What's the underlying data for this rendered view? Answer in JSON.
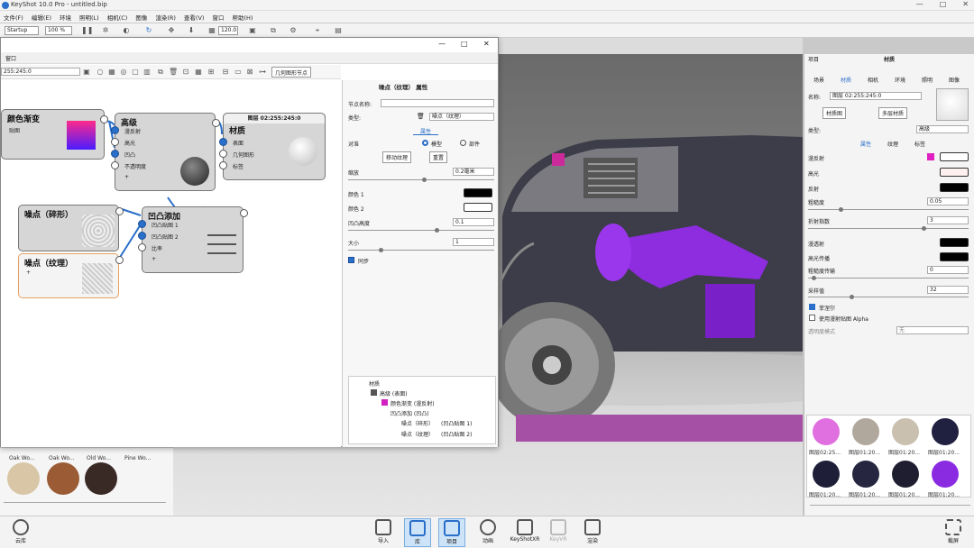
{
  "app": {
    "title": "KeyShot 10.0 Pro - untitled.bip",
    "window_controls": [
      "—",
      "□",
      "✕"
    ]
  },
  "menu": [
    "文件(F)",
    "编辑(E)",
    "环境",
    "照明(L)",
    "相机(C)",
    "图像",
    "渲染(R)",
    "查看(V)",
    "窗口",
    "帮助(H)"
  ],
  "toolbar": {
    "workspace": "Startup",
    "zoom": "100 %",
    "value": "120.0"
  },
  "graph_window": {
    "title_controls": [
      "—",
      "□",
      "✕"
    ],
    "tab": "窗口",
    "material_field": "255:245:0",
    "geom_node_button": "几何图形节点",
    "nodes": {
      "gradient": {
        "title": "颜色渐变",
        "rows": [
          "贴图"
        ]
      },
      "advanced": {
        "title": "高级",
        "rows": [
          "漫反射",
          "高光",
          "凹凸",
          "不透明度",
          "+"
        ]
      },
      "material": {
        "title": "材质",
        "header": "图层 02:255:245:0",
        "rows": [
          "表面",
          "几何图形",
          "标签"
        ]
      },
      "noise_fractal": {
        "title": "噪点（碎形）"
      },
      "bump_add": {
        "title": "凹凸添加",
        "rows": [
          "凹凸贴图 1",
          "凹凸贴图 2",
          "比率",
          "+"
        ]
      },
      "noise_texture": {
        "title": "噪点（纹理）",
        "rows": [
          "+"
        ]
      }
    },
    "properties": {
      "header": "噪点（纹理） 属性",
      "node_name_label": "节点名称:",
      "type_label": "类型:",
      "type_value": "噪点（纹理）",
      "tab": "属性",
      "target_label": "对准",
      "radio_model": "模型",
      "radio_part": "部件",
      "move_texture": "移动纹理",
      "reset": "重置",
      "scale_label": "缩放",
      "scale_value": "0.2毫米",
      "color1_label": "颜色 1",
      "color2_label": "颜色 2",
      "bump_label": "凹凸高度",
      "bump_value": "0.1",
      "size_label": "大小",
      "size_value": "1",
      "sync_label": "同步",
      "tree": [
        {
          "label": "材质",
          "extra": ""
        },
        {
          "label": "高级 (表面)",
          "extra": ""
        },
        {
          "label": "颜色渐变 (漫反射)",
          "extra": ""
        },
        {
          "label": "凹凸添加 (凹凸)",
          "extra": ""
        },
        {
          "label": "噪点（碎形）",
          "extra": "(凹凸贴图 1)"
        },
        {
          "label": "噪点（纹理）",
          "extra": "(凹凸贴图 2)"
        }
      ]
    }
  },
  "library": {
    "items": [
      {
        "label": "Oak Wo...",
        "color": "#d8c6a6"
      },
      {
        "label": "Oak Wo...",
        "color": "#9a5b35"
      },
      {
        "label": "Old Wo...",
        "color": "#3a2a26"
      },
      {
        "label": "Pine Wo...",
        "color": "#c9a070"
      }
    ]
  },
  "right_panel": {
    "header_left": "项目",
    "header_title": "材质",
    "tabs": [
      "场景",
      "材质",
      "相机",
      "环境",
      "照明",
      "图像"
    ],
    "name_label": "名称:",
    "name_value": "图层 02:255:245:0",
    "material_graph_btn": "材质图",
    "multi_layer_btn": "多层材质",
    "type_label": "类型:",
    "type_value": "高级",
    "subtabs": [
      "属性",
      "纹理",
      "标签"
    ],
    "props": [
      {
        "label": "漫反射",
        "kind": "color",
        "color": "#ffffff"
      },
      {
        "label": "高光",
        "kind": "color",
        "color": "#fdf0ee"
      },
      {
        "label": "反射",
        "kind": "color",
        "color": "#000000"
      },
      {
        "label": "粗糙度",
        "kind": "num",
        "value": "0.05"
      },
      {
        "label": "折射指数",
        "kind": "num",
        "value": "3"
      },
      {
        "label": "漫透射",
        "kind": "color",
        "color": "#000000"
      },
      {
        "label": "高光传播",
        "kind": "color",
        "color": "#000000"
      },
      {
        "label": "粗糙度传输",
        "kind": "num",
        "value": "0"
      },
      {
        "label": "采样值",
        "kind": "num",
        "value": "32"
      }
    ],
    "fresnel": "菲涅尔",
    "alpha": "使用漫射贴图 Alpha",
    "transparency_label": "透明度模式",
    "transparency_value": "无",
    "swatches": [
      {
        "label": "图层02:25...",
        "color": "#e070e0"
      },
      {
        "label": "图层01:20...",
        "color": "#b0a89c"
      },
      {
        "label": "图层01:20...",
        "color": "#c9c0b0"
      },
      {
        "label": "图层01:20...",
        "color": "#202040"
      },
      {
        "label": "图层01:20...",
        "color": "#1e1e38"
      },
      {
        "label": "图层01:20...",
        "color": "#262640"
      },
      {
        "label": "图层01:20...",
        "color": "#1e1e30"
      },
      {
        "label": "图层01:20...",
        "color": "#8a2be2"
      }
    ]
  },
  "bottom": {
    "left": "云库",
    "items": [
      "导入",
      "库",
      "项目",
      "动画",
      "KeyShotXR",
      "KeyVR",
      "渲染"
    ],
    "right": "截屏"
  }
}
